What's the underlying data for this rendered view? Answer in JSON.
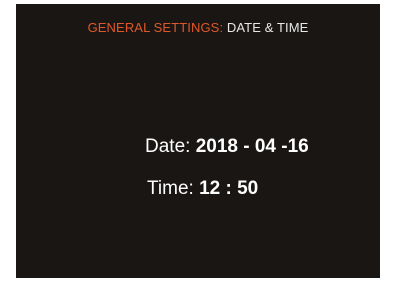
{
  "header": {
    "section": "GENERAL SETTINGS:",
    "page": "DATE & TIME"
  },
  "date": {
    "label": "Date:",
    "value": "2018 - 04 -16"
  },
  "time": {
    "label": "Time:",
    "value": "12 : 50"
  },
  "colors": {
    "background": "#1a1614",
    "accent": "#e0582a",
    "text": "#ffffff"
  }
}
